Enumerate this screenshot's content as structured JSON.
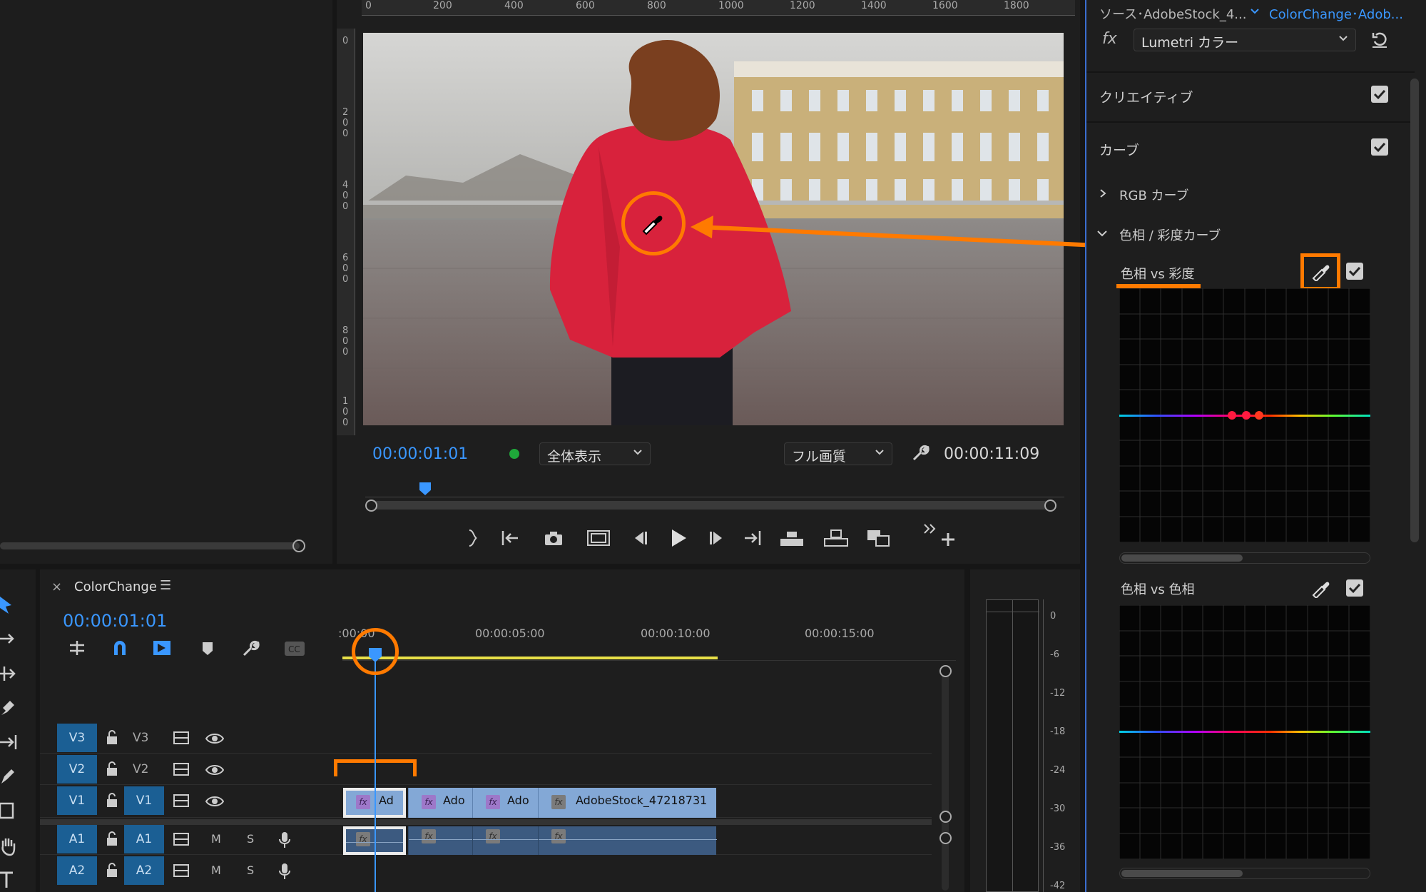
{
  "program_monitor": {
    "ruler_labels": [
      "0",
      "200",
      "400",
      "600",
      "800",
      "1000",
      "1200",
      "1400",
      "1600",
      "1800"
    ],
    "vruler_labels": [
      "0",
      "2\n0\n0",
      "4\n0\n0",
      "6\n0\n0",
      "8\n0\n0",
      "1\n0\n0"
    ],
    "timecode_current": "00:00:01:01",
    "zoom": "全体表示",
    "quality": "フル画質",
    "timecode_duration": "00:00:11:09"
  },
  "effect_controls": {
    "tab_source": "ソース･AdobeStock_4...",
    "tab_sequence": "ColorChange･Adob...",
    "fx_label": "fx",
    "effect": "Lumetri カラー",
    "section_creative": "クリエイティブ",
    "section_curves": "カーブ",
    "rgb_curve": "RGB カーブ",
    "hue_sat_curves": "色相 / 彩度カーブ",
    "hue_vs_sat": "色相 vs 彩度",
    "hue_vs_hue": "色相 vs 色相"
  },
  "timeline": {
    "close": "×",
    "sequence_name": "ColorChange",
    "menu": "☰",
    "timecode": "00:00:01:01",
    "ruler": [
      ":00:00",
      "00:00:05:00",
      "00:00:10:00",
      "00:00:15:00"
    ],
    "tracks": [
      {
        "src": "V3",
        "tgt": "V3"
      },
      {
        "src": "V2",
        "tgt": "V2"
      },
      {
        "src": "V1",
        "tgt": "V1"
      },
      {
        "src": "A1",
        "tgt": "A1",
        "m": "M",
        "s": "S"
      },
      {
        "src": "A2",
        "tgt": "A2",
        "m": "M",
        "s": "S"
      }
    ],
    "clips": [
      "Ad",
      "Ado",
      "Ado",
      "AdobeStock_47218731"
    ],
    "fx_badge": "fx"
  },
  "audio_meter": {
    "scale": [
      "0",
      "-6",
      "-12",
      "-18",
      "-24",
      "-30",
      "-36",
      "-42"
    ]
  },
  "colors": {
    "accent_blue": "#3a97ff",
    "annotation_orange": "#ff7a00",
    "track_blue": "#1b5f94",
    "clip_blue": "#83a8d6"
  }
}
